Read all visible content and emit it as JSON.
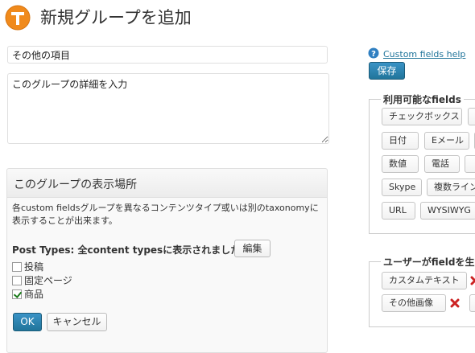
{
  "header": {
    "title": "新規グループを追加"
  },
  "form": {
    "name_value": "その他の項目",
    "description_value": "このグループの詳細を入力"
  },
  "display_panel": {
    "title": "このグループの表示場所",
    "description": "各custom fieldsグループを異なるコンテンツタイプ或いは別のtaxonomyに表示することが出来ます。",
    "post_types_label": "Post Types: 全content typesに表示されました",
    "edit_label": "編集",
    "post_types": [
      {
        "label": "投稿",
        "checked": false
      },
      {
        "label": "固定ページ",
        "checked": false
      },
      {
        "label": "商品",
        "checked": true
      }
    ],
    "ok_label": "OK",
    "cancel_label": "キャンセル"
  },
  "sidebar": {
    "help_link": "Custom fields help",
    "save_label": "保存",
    "available_legend": "利用可能なfields",
    "available_fields": [
      "チェックボックス",
      "日付",
      "Eメール",
      "数値",
      "電話",
      "Skype",
      "複数ライン",
      "URL",
      "WYSIWYG"
    ],
    "user_legend": "ユーザーがfieldを生",
    "user_fields": [
      "カスタムテキスト",
      "その他画像"
    ]
  },
  "colors": {
    "accent": "#21759b",
    "logo": "#f08a1c",
    "delete": "#cc2222"
  }
}
